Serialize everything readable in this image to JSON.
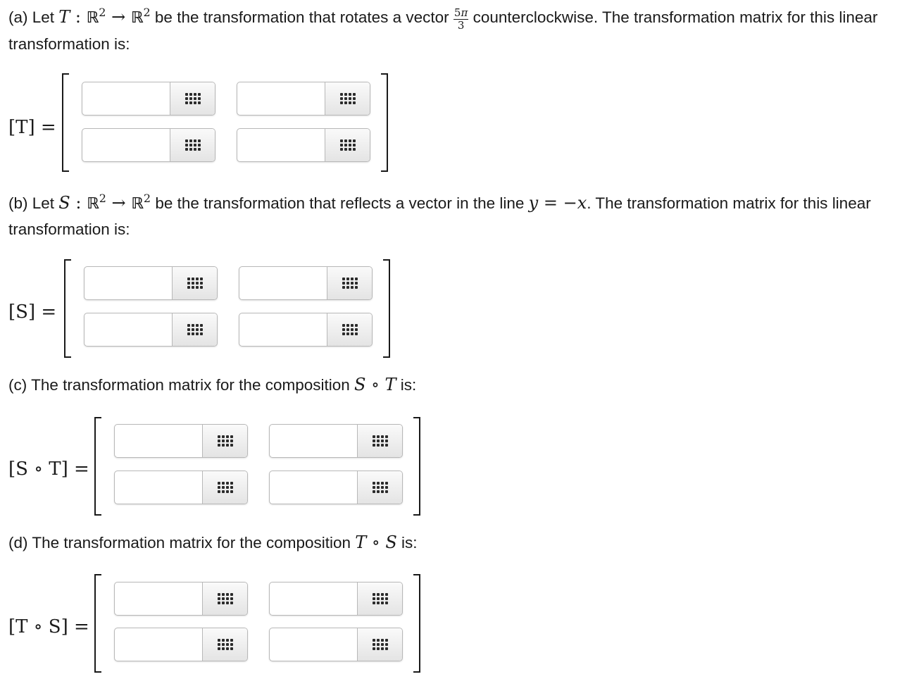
{
  "part_a": {
    "prefix": "(a) Let ",
    "map": "T",
    "colon": " : ",
    "set": "ℝ",
    "exp": "2",
    "arrow": " → ",
    "mid": " be the transformation that rotates a vector ",
    "frac_num": "5",
    "frac_pi": "π",
    "frac_den": "3",
    "suffix": " counterclockwise. The transformation matrix for this linear transformation is:",
    "matrix_label": "[T] =",
    "cells": [
      {
        "value": "",
        "placeholder": ""
      },
      {
        "value": "",
        "placeholder": ""
      },
      {
        "value": "",
        "placeholder": ""
      },
      {
        "value": "",
        "placeholder": ""
      }
    ]
  },
  "part_b": {
    "prefix": "(b) Let ",
    "map": "S",
    "colon": " : ",
    "set": "ℝ",
    "exp": "2",
    "arrow": " → ",
    "mid": " be the transformation that reflects a vector in the line ",
    "eq_y": "y",
    "eq_mid": " = −",
    "eq_x": "x",
    "suffix": ". The transformation matrix for this linear transformation is:",
    "matrix_label": "[S] =",
    "cells": [
      {
        "value": "",
        "placeholder": ""
      },
      {
        "value": "",
        "placeholder": ""
      },
      {
        "value": "",
        "placeholder": ""
      },
      {
        "value": "",
        "placeholder": ""
      }
    ]
  },
  "part_c": {
    "prefix": "(c) The transformation matrix for the composition ",
    "first": "S",
    "comp": " ∘ ",
    "second": "T",
    "suffix": " is:",
    "matrix_label": "[S ∘ T] =",
    "cells": [
      {
        "value": "",
        "placeholder": ""
      },
      {
        "value": "",
        "placeholder": ""
      },
      {
        "value": "",
        "placeholder": ""
      },
      {
        "value": "",
        "placeholder": ""
      }
    ]
  },
  "part_d": {
    "prefix": "(d) The transformation matrix for the composition ",
    "first": "T",
    "comp": " ∘ ",
    "second": "S",
    "suffix": " is:",
    "matrix_label": "[T ∘ S] =",
    "cells": [
      {
        "value": "",
        "placeholder": ""
      },
      {
        "value": "",
        "placeholder": ""
      },
      {
        "value": "",
        "placeholder": ""
      },
      {
        "value": "",
        "placeholder": ""
      }
    ]
  },
  "icons": {
    "entry_palette": "keypad-grid-icon"
  },
  "colors": {
    "text": "#1a1a1a",
    "cell_border": "#b8b8b8",
    "keypad_bg": "#e9e9e9"
  }
}
